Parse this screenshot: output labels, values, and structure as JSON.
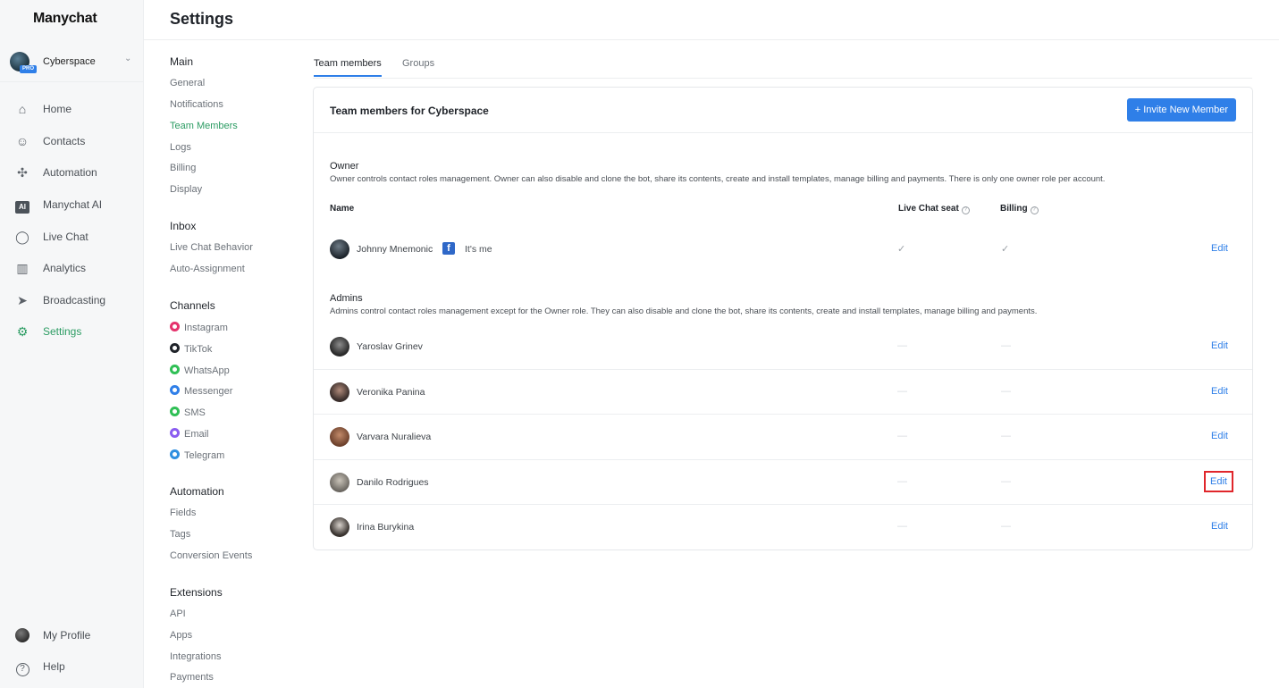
{
  "app": {
    "logo": "Manychat",
    "page_title": "Settings"
  },
  "account": {
    "name": "Cyberspace",
    "badge": "PRO"
  },
  "sidebar": {
    "items": [
      {
        "label": "Home",
        "icon": "home-icon",
        "glyph": "⌂"
      },
      {
        "label": "Contacts",
        "icon": "user-icon",
        "glyph": "☺"
      },
      {
        "label": "Automation",
        "icon": "automation-icon",
        "glyph": "✣"
      },
      {
        "label": "Manychat AI",
        "icon": "ai-icon",
        "glyph": "AI"
      },
      {
        "label": "Live Chat",
        "icon": "chat-icon",
        "glyph": "◯"
      },
      {
        "label": "Analytics",
        "icon": "analytics-icon",
        "glyph": "▥"
      },
      {
        "label": "Broadcasting",
        "icon": "send-icon",
        "glyph": "➤"
      },
      {
        "label": "Settings",
        "icon": "gear-icon",
        "glyph": "⚙"
      }
    ],
    "bottom": [
      {
        "label": "My Profile",
        "icon": "profile-avatar-icon"
      },
      {
        "label": "Help",
        "icon": "help-icon",
        "glyph": "?"
      }
    ]
  },
  "submenu": {
    "main": {
      "title": "Main",
      "items": [
        "General",
        "Notifications",
        "Team Members",
        "Logs",
        "Billing",
        "Display"
      ]
    },
    "inbox": {
      "title": "Inbox",
      "items": [
        "Live Chat Behavior",
        "Auto-Assignment"
      ]
    },
    "channels": {
      "title": "Channels",
      "items": [
        {
          "label": "Instagram",
          "color": "#e5326c"
        },
        {
          "label": "TikTok",
          "color": "#1f2329"
        },
        {
          "label": "WhatsApp",
          "color": "#2fbf55"
        },
        {
          "label": "Messenger",
          "color": "#2f7fe8"
        },
        {
          "label": "SMS",
          "color": "#2fbf55"
        },
        {
          "label": "Email",
          "color": "#8a5cf0"
        },
        {
          "label": "Telegram",
          "color": "#2f8fe0"
        }
      ]
    },
    "automation": {
      "title": "Automation",
      "items": [
        "Fields",
        "Tags",
        "Conversion Events"
      ]
    },
    "extensions": {
      "title": "Extensions",
      "items": [
        "API",
        "Apps",
        "Integrations",
        "Payments"
      ]
    }
  },
  "tabs": [
    "Team members",
    "Groups"
  ],
  "team": {
    "title": "Team members for Cyberspace",
    "invite_label": "+ Invite New Member",
    "owner": {
      "title": "Owner",
      "description": "Owner controls contact roles management. Owner can also disable and clone the bot, share its contents, create and install templates, manage billing and payments. There is only one owner role per account."
    },
    "columns": {
      "name": "Name",
      "live_chat_seat": "Live Chat seat",
      "billing": "Billing"
    },
    "owner_member": {
      "name": "Johnny Mnemonic",
      "me_label": "It's me",
      "live_chat": "✓",
      "billing": "✓",
      "edit": "Edit"
    },
    "admins": {
      "title": "Admins",
      "description": "Admins control contact roles management except for the Owner role. They can also disable and clone the bot, share its contents, create and install templates, manage billing and payments."
    },
    "admin_members": [
      {
        "name": "Yaroslav Grinev",
        "live_chat": "—",
        "billing": "—",
        "edit": "Edit"
      },
      {
        "name": "Veronika Panina",
        "live_chat": "—",
        "billing": "—",
        "edit": "Edit"
      },
      {
        "name": "Varvara Nuralieva",
        "live_chat": "—",
        "billing": "—",
        "edit": "Edit"
      },
      {
        "name": "Danilo Rodrigues",
        "live_chat": "—",
        "billing": "—",
        "edit": "Edit"
      },
      {
        "name": "Irina Burykina",
        "live_chat": "—",
        "billing": "—",
        "edit": "Edit"
      }
    ]
  },
  "colors": {
    "accent": "#2f7fe8",
    "active_green": "#2c9c63",
    "highlight_red": "#e0262b"
  }
}
